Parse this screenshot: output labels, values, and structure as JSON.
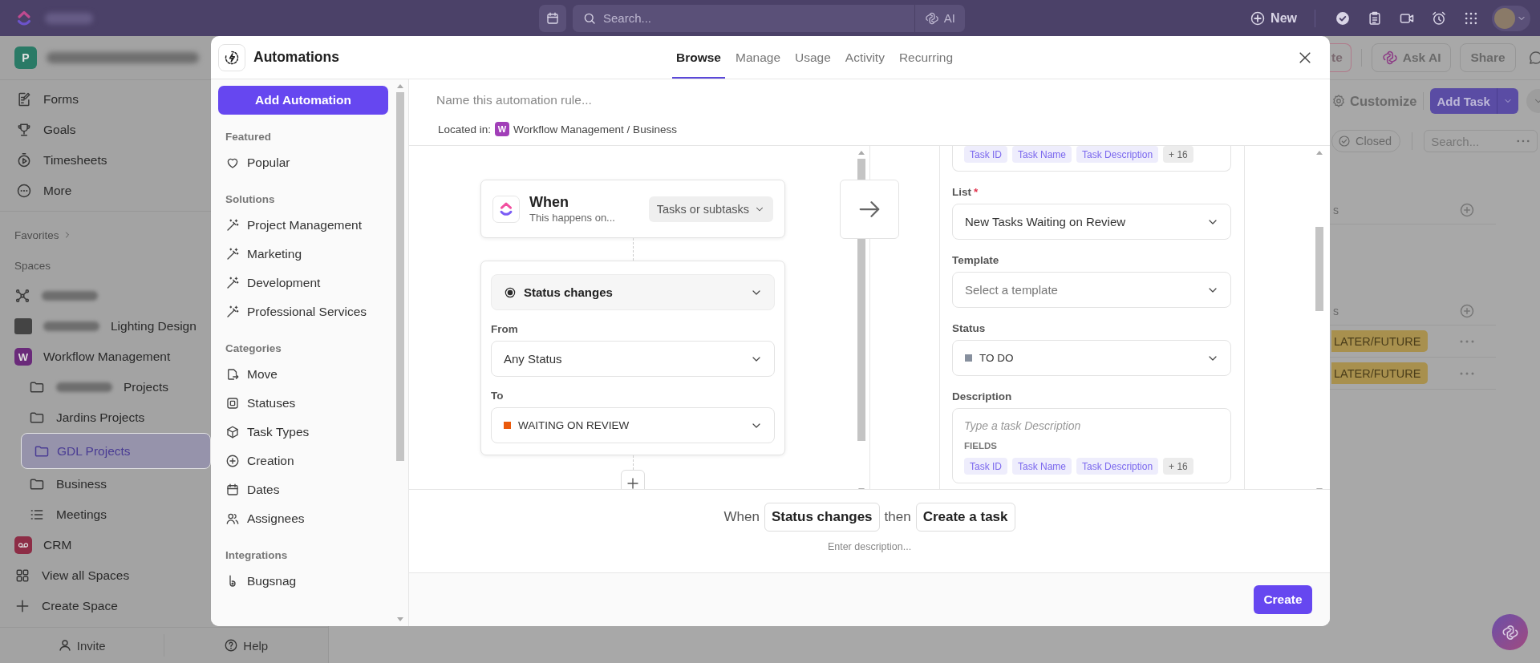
{
  "topbar": {
    "search_placeholder": "Search...",
    "ai_label": "AI",
    "new_label": "New"
  },
  "sidebar": {
    "workspace_initial": "P",
    "nav": [
      {
        "kind": "forms",
        "label": "Forms"
      },
      {
        "kind": "goals",
        "label": "Goals"
      },
      {
        "kind": "timesheets",
        "label": "Timesheets"
      },
      {
        "kind": "more",
        "label": "More"
      }
    ],
    "favorites_label": "Favorites",
    "spaces_label": "Spaces",
    "spaces": [
      {
        "kind": "network",
        "redacted": true,
        "selected": false
      },
      {
        "kind": "photo",
        "label": "Lighting Design",
        "redacted": true,
        "selected": false
      },
      {
        "kind": "space",
        "avatar": "W",
        "color": "#6a2a7a",
        "label": "Workflow Management",
        "redacted": false,
        "selected": false,
        "children": [
          {
            "kind": "folder",
            "label": "Projects",
            "redacted": true,
            "selected": false
          },
          {
            "kind": "folder",
            "label": "Jardins Projects",
            "redacted": false,
            "selected": false
          },
          {
            "kind": "folder",
            "label": "GDL Projects",
            "redacted": false,
            "selected": true
          },
          {
            "kind": "folder",
            "label": "Business",
            "redacted": false,
            "selected": false
          },
          {
            "kind": "list",
            "label": "Meetings",
            "redacted": false,
            "selected": false
          }
        ]
      },
      {
        "kind": "voicemail",
        "color": "#8d2d46",
        "label": "CRM",
        "redacted": false,
        "selected": false
      }
    ],
    "links": [
      {
        "kind": "grid",
        "label": "View all Spaces"
      },
      {
        "kind": "plus",
        "label": "Create Space"
      }
    ],
    "footer": [
      {
        "kind": "user",
        "label": "Invite"
      },
      {
        "kind": "help",
        "label": "Help"
      }
    ]
  },
  "background": {
    "toolbar": [
      {
        "kind": "outlined",
        "label": "te"
      },
      {
        "kind": "ai",
        "label": "Ask AI"
      },
      {
        "kind": "plain",
        "label": "Share"
      }
    ],
    "customize_label": "Customize",
    "add_task_label": "Add Task",
    "closed_label": "Closed",
    "search_placeholder": "Search...",
    "groups": [
      {
        "label": "s"
      },
      {
        "label": "s"
      }
    ],
    "rows": [
      {
        "tag": "LATER/FUTURE"
      },
      {
        "tag": "LATER/FUTURE"
      }
    ]
  },
  "modal": {
    "title": "Automations",
    "tabs": [
      {
        "label": "Browse",
        "selected": true
      },
      {
        "label": "Manage",
        "selected": false
      },
      {
        "label": "Usage",
        "selected": false
      },
      {
        "label": "Activity",
        "selected": false
      },
      {
        "label": "Recurring",
        "selected": false
      }
    ],
    "add_label": "Add Automation",
    "sections": [
      {
        "title": "Featured",
        "items": [
          {
            "kind": "heart",
            "label": "Popular"
          }
        ]
      },
      {
        "title": "Solutions",
        "items": [
          {
            "kind": "wand",
            "label": "Project Management"
          },
          {
            "kind": "wand",
            "label": "Marketing"
          },
          {
            "kind": "wand",
            "label": "Development"
          },
          {
            "kind": "wand",
            "label": "Professional Services"
          }
        ]
      },
      {
        "title": "Categories",
        "items": [
          {
            "kind": "move",
            "label": "Move"
          },
          {
            "kind": "statuses",
            "label": "Statuses"
          },
          {
            "kind": "cube",
            "label": "Task Types"
          },
          {
            "kind": "pluscircle",
            "label": "Creation"
          },
          {
            "kind": "calendar",
            "label": "Dates"
          },
          {
            "kind": "users",
            "label": "Assignees"
          }
        ]
      },
      {
        "title": "Integrations",
        "items": [
          {
            "kind": "bugsnag",
            "label": "Bugsnag"
          }
        ]
      }
    ],
    "name_placeholder": "Name this automation rule...",
    "located_label": "Located in:",
    "location_badge": {
      "label": "W",
      "color": "#a13fb8"
    },
    "location": "Workflow Management / Business",
    "trigger": {
      "title": "When",
      "subtitle": "This happens on...",
      "scope": "Tasks or subtasks",
      "condition": "Status changes",
      "from_label": "From",
      "from": "Any Status",
      "to_label": "To",
      "to": {
        "label": "WAITING ON REVIEW",
        "color": "#ea5a0c"
      }
    },
    "action": {
      "top_chips": [
        "Task ID",
        "Task Name",
        "Task Description",
        "+ 16"
      ],
      "list_label": "List",
      "required_mark": "*",
      "list": "New Tasks Waiting on Review",
      "template_label": "Template",
      "template_placeholder": "Select a template",
      "status_label": "Status",
      "status": {
        "label": "TO DO",
        "color": "#87909e"
      },
      "description_label": "Description",
      "description_placeholder": "Type a task Description",
      "fields_label": "FIELDS",
      "chips": [
        "Task ID",
        "Task Name",
        "Task Description",
        "+ 16"
      ]
    },
    "summary": {
      "when": "When",
      "trigger": "Status changes",
      "then": "then",
      "action": "Create a task",
      "description_placeholder": "Enter description..."
    },
    "create_label": "Create"
  }
}
